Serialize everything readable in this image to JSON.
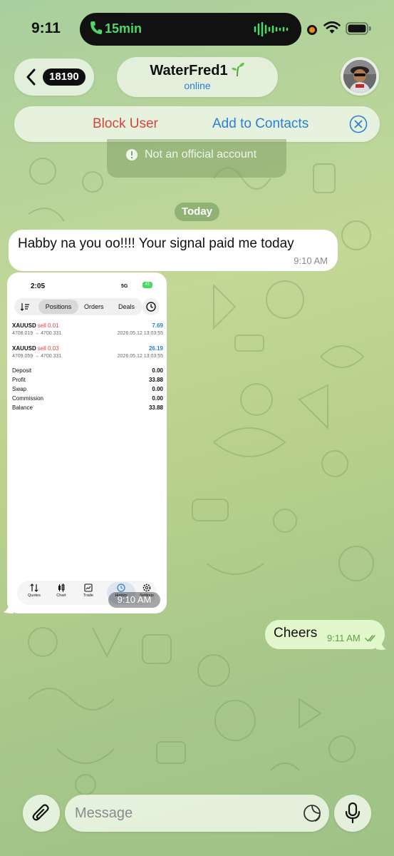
{
  "status_bar": {
    "time": "9:11",
    "call_duration": "15min",
    "accent_call": "#4cd964"
  },
  "nav": {
    "back_badge": "18190",
    "chat_name": "WaterFred1",
    "chat_status": "online"
  },
  "actions": {
    "block_label": "Block User",
    "add_label": "Add to Contacts",
    "notice": "Not an official account"
  },
  "date_separator": "Today",
  "messages": [
    {
      "direction": "in",
      "text": "Habby na you oo!!!! Your signal paid me today",
      "time": "9:10 AM"
    },
    {
      "direction": "in",
      "type": "photo",
      "time": "9:10 AM"
    },
    {
      "direction": "out",
      "text": "Cheers",
      "time": "9:11 AM",
      "read": true
    }
  ],
  "photo": {
    "time": "2:05",
    "network": "5G",
    "battery": "41",
    "tabs": [
      "Positions",
      "Orders",
      "Deals"
    ],
    "trades": [
      {
        "symbol": "XAUUSD",
        "side": "sell 0.01",
        "profit": "7.69",
        "prices": "4708.019 → 4700.331",
        "date": "2026.05.12 13:03:55"
      },
      {
        "symbol": "XAUUSD",
        "side": "sell 0.03",
        "profit": "26.19",
        "prices": "4709.059 → 4700.331",
        "date": "2026.05.12 13:03:55"
      }
    ],
    "summary": [
      {
        "label": "Deposit",
        "value": "0.00"
      },
      {
        "label": "Profit",
        "value": "33.88"
      },
      {
        "label": "Swap",
        "value": "0.00"
      },
      {
        "label": "Commission",
        "value": "0.00"
      },
      {
        "label": "Balance",
        "value": "33.88"
      }
    ],
    "nav": [
      "Quotes",
      "Chart",
      "Trade",
      "History",
      "Settings"
    ]
  },
  "input": {
    "placeholder": "Message"
  },
  "colors": {
    "block": "#d6453b",
    "link": "#2c7fd6",
    "outgoing_bubble": "#e2f7cb"
  }
}
